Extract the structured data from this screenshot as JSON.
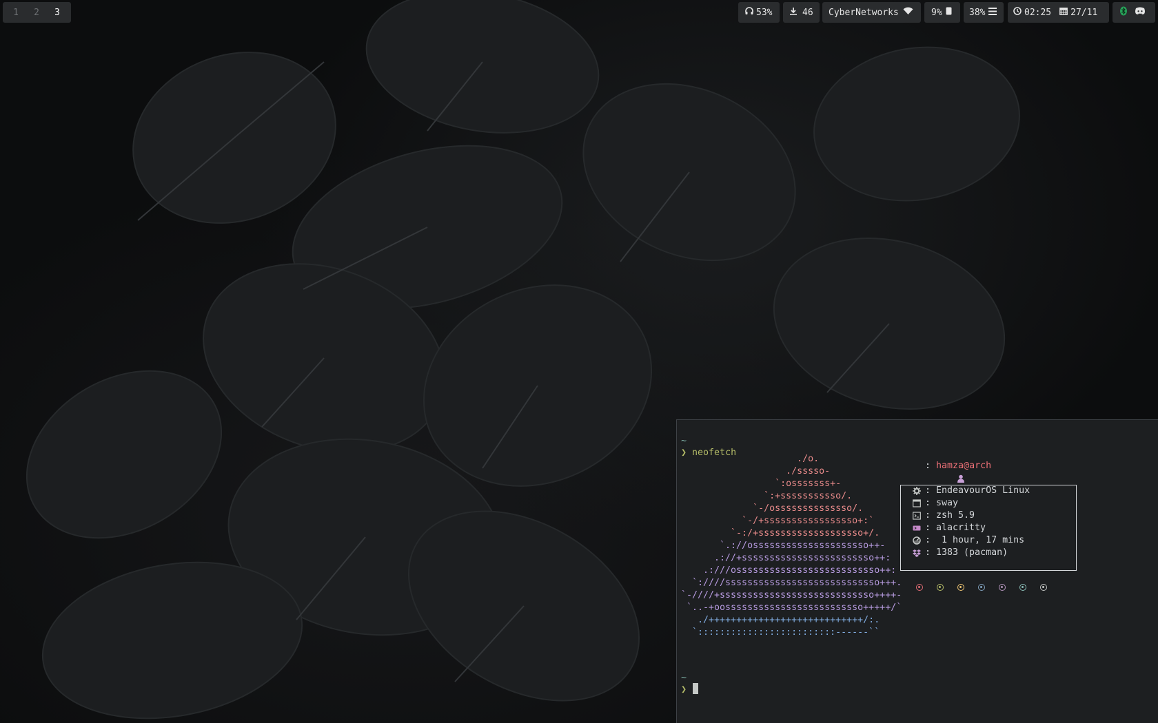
{
  "workspaces": [
    {
      "label": "1",
      "active": false
    },
    {
      "label": "2",
      "active": false
    },
    {
      "label": "3",
      "active": true
    }
  ],
  "status": {
    "volume": {
      "icon": "headphones-icon",
      "value": "53%"
    },
    "updates": {
      "icon": "download-icon",
      "value": "46"
    },
    "network": {
      "ssid": "CyberNetworks",
      "icon": "wifi-icon"
    },
    "cpu": {
      "value": "9%",
      "icon": "cpu-icon"
    },
    "memory": {
      "value": "38%",
      "icon": "menu-icon"
    },
    "clock": {
      "icon": "clock-icon",
      "time": "02:25"
    },
    "date": {
      "icon": "calendar-icon",
      "value": "27/11"
    },
    "tray": [
      "bluetooth-icon",
      "discord-icon"
    ]
  },
  "terminal": {
    "prompt_dir": "~",
    "prompt_symbol": "❯",
    "command": "neofetch",
    "logo": [
      [
        [
          "",
          "                     ./o."
        ]
      ],
      [
        [
          "",
          "                   ./sssso-"
        ]
      ],
      [
        [
          "",
          "                 `:osssssss+-"
        ]
      ],
      [
        [
          "",
          "               `:+sssssssssso/."
        ]
      ],
      [
        [
          "",
          "             `-/ossssssssssssso/."
        ]
      ],
      [
        [
          "",
          "           `-/+sssssssssssssssso+:`"
        ]
      ],
      [
        [
          "",
          "         `-:/+sssssssssssssssssso+/."
        ]
      ],
      [
        [
          "",
          "       `.://osssssssssssssssssssso++-"
        ]
      ],
      [
        [
          "",
          "      .://+ssssssssssssssssssssssso++:"
        ]
      ],
      [
        [
          "",
          "    .:///ossssssssssssssssssssssssso++:"
        ]
      ],
      [
        [
          "",
          "  `:////ssssssssssssssssssssssssssso+++."
        ]
      ],
      [
        [
          "",
          "`-////+ssssssssssssssssssssssssssso++++-"
        ]
      ],
      [
        [
          "",
          " `..-+oosssssssssssssssssssssssso+++++/`"
        ]
      ],
      [
        [
          "",
          "   ./++++++++++++++++++++++++++++/:."
        ]
      ],
      [
        [
          "",
          "  `:::::::::::::::::::::::::------``"
        ]
      ]
    ],
    "info": {
      "user": "hamza",
      "at": "@",
      "host": "arch",
      "sep": ": ",
      "rows": [
        {
          "icon": "gear-icon",
          "value": "EndeavourOS Linux"
        },
        {
          "icon": "window-icon",
          "value": "sway"
        },
        {
          "icon": "terminal-icon",
          "value": "zsh 5.9"
        },
        {
          "icon": "app-icon",
          "value": "alacritty"
        },
        {
          "icon": "uptime-icon",
          "value": " 1 hour, 17 mins"
        },
        {
          "icon": "package-icon",
          "value": "1383 (pacman)"
        }
      ]
    },
    "palette": [
      "#e06c75",
      "#b5bd68",
      "#f0c674",
      "#81a2be",
      "#b294bb",
      "#8abeb7",
      "#c5c8c6"
    ]
  }
}
